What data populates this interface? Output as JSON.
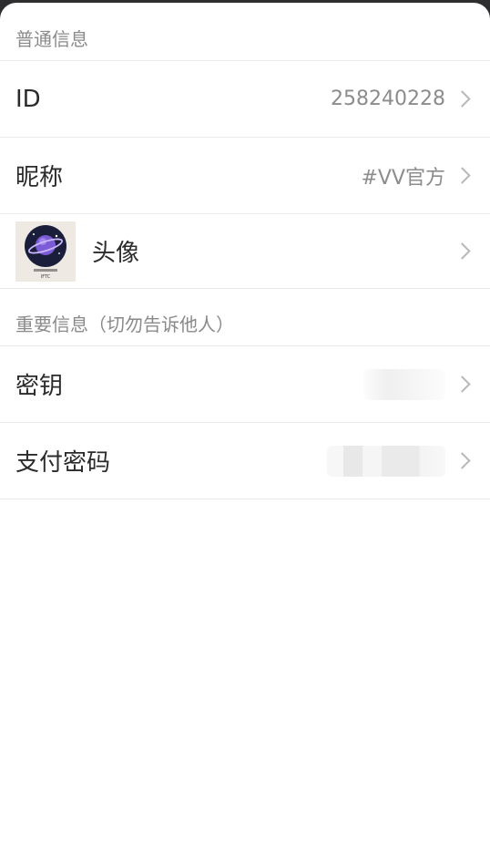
{
  "sections": {
    "general_title": "普通信息",
    "important_title": "重要信息（切勿告诉他人）"
  },
  "rows": {
    "id": {
      "label": "ID",
      "value": "258240228"
    },
    "nickname": {
      "label": "昵称",
      "value": "#VV官方"
    },
    "avatar": {
      "label": "头像",
      "logo_text": "IFTC"
    },
    "secret_key": {
      "label": "密钥"
    },
    "pay_password": {
      "label": "支付密码"
    }
  },
  "icons": {
    "chevron": "chevron-right-icon",
    "avatar_image": "planet-logo"
  },
  "colors": {
    "background": "#ffffff",
    "label": "#2b2b2b",
    "secondary": "#8c8c8c",
    "divider": "#e9e9e9"
  }
}
